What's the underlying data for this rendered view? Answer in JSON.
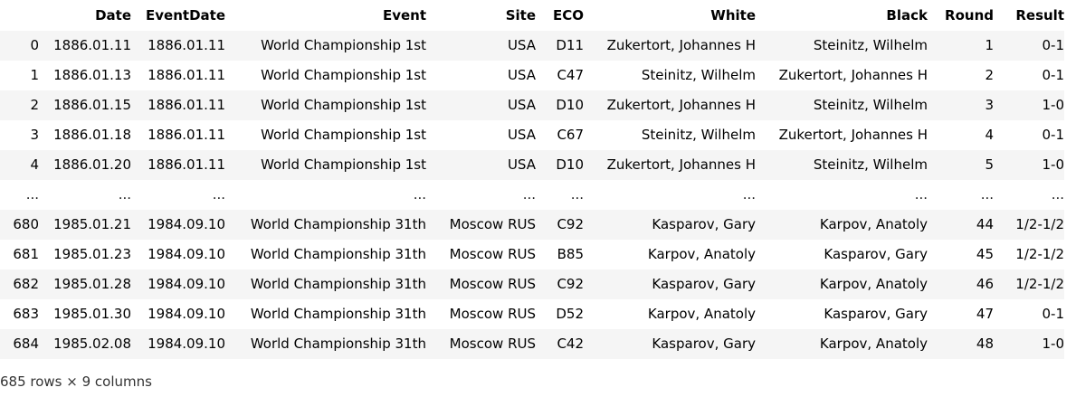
{
  "table": {
    "columns": [
      "",
      "Date",
      "EventDate",
      "Event",
      "Site",
      "ECO",
      "White",
      "Black",
      "Round",
      "Result"
    ],
    "rows": [
      [
        "0",
        "1886.01.11",
        "1886.01.11",
        "World Championship 1st",
        "USA",
        "D11",
        "Zukertort, Johannes H",
        "Steinitz, Wilhelm",
        "1",
        "0-1"
      ],
      [
        "1",
        "1886.01.13",
        "1886.01.11",
        "World Championship 1st",
        "USA",
        "C47",
        "Steinitz, Wilhelm",
        "Zukertort, Johannes H",
        "2",
        "0-1"
      ],
      [
        "2",
        "1886.01.15",
        "1886.01.11",
        "World Championship 1st",
        "USA",
        "D10",
        "Zukertort, Johannes H",
        "Steinitz, Wilhelm",
        "3",
        "1-0"
      ],
      [
        "3",
        "1886.01.18",
        "1886.01.11",
        "World Championship 1st",
        "USA",
        "C67",
        "Steinitz, Wilhelm",
        "Zukertort, Johannes H",
        "4",
        "0-1"
      ],
      [
        "4",
        "1886.01.20",
        "1886.01.11",
        "World Championship 1st",
        "USA",
        "D10",
        "Zukertort, Johannes H",
        "Steinitz, Wilhelm",
        "5",
        "1-0"
      ],
      [
        "...",
        "...",
        "...",
        "...",
        "...",
        "...",
        "...",
        "...",
        "...",
        "..."
      ],
      [
        "680",
        "1985.01.21",
        "1984.09.10",
        "World Championship 31th",
        "Moscow RUS",
        "C92",
        "Kasparov, Gary",
        "Karpov, Anatoly",
        "44",
        "1/2-1/2"
      ],
      [
        "681",
        "1985.01.23",
        "1984.09.10",
        "World Championship 31th",
        "Moscow RUS",
        "B85",
        "Karpov, Anatoly",
        "Kasparov, Gary",
        "45",
        "1/2-1/2"
      ],
      [
        "682",
        "1985.01.28",
        "1984.09.10",
        "World Championship 31th",
        "Moscow RUS",
        "C92",
        "Kasparov, Gary",
        "Karpov, Anatoly",
        "46",
        "1/2-1/2"
      ],
      [
        "683",
        "1985.01.30",
        "1984.09.10",
        "World Championship 31th",
        "Moscow RUS",
        "D52",
        "Karpov, Anatoly",
        "Kasparov, Gary",
        "47",
        "0-1"
      ],
      [
        "684",
        "1985.02.08",
        "1984.09.10",
        "World Championship 31th",
        "Moscow RUS",
        "C42",
        "Kasparov, Gary",
        "Karpov, Anatoly",
        "48",
        "1-0"
      ]
    ]
  },
  "footer": {
    "summary": "685 rows × 9 columns"
  },
  "colors": {
    "stripe": "#f5f5f5",
    "background": "#ffffff"
  }
}
